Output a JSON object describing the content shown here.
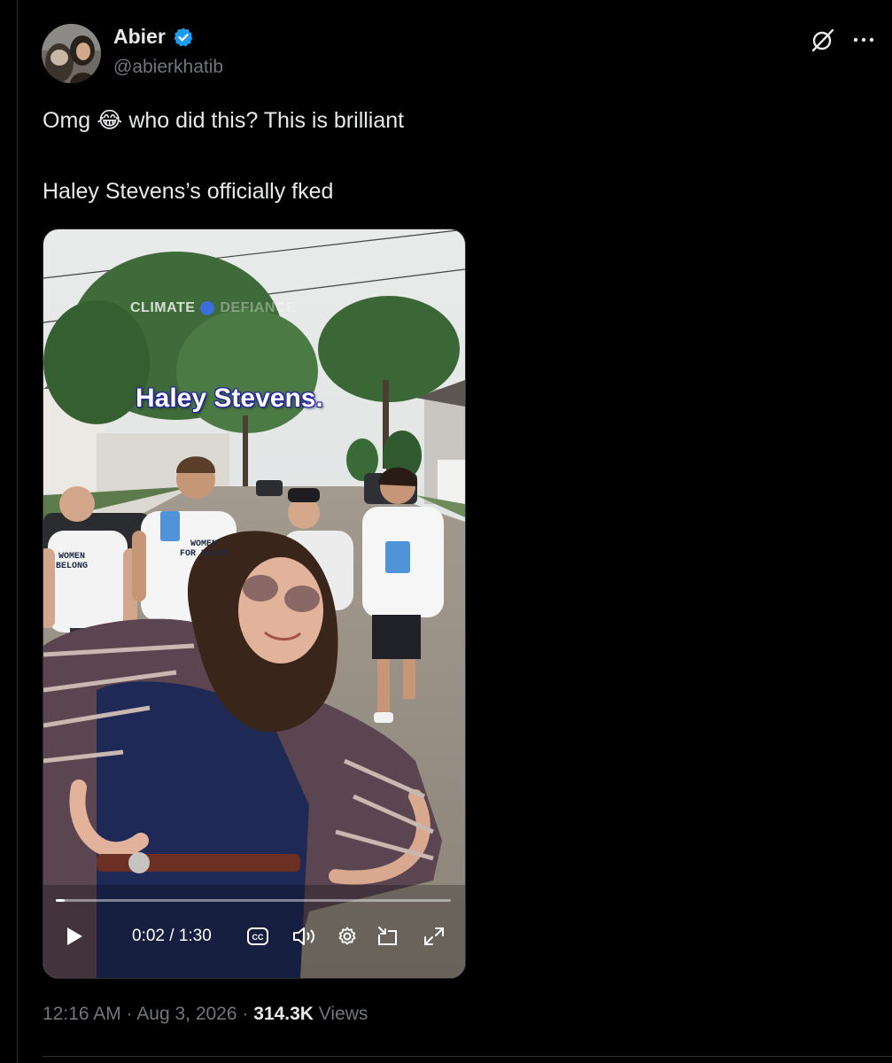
{
  "author": {
    "name": "Abier",
    "handle": "@abierkhatib",
    "verified": true
  },
  "tweet": {
    "line1_before": "Omg",
    "emoji": "😂",
    "line1_after": "who did this? This is brilliant",
    "line2": "Haley Stevens’s officially fked"
  },
  "video": {
    "watermark_left": "CLIMATE",
    "watermark_right": "DEFIANCE",
    "caption": "Haley Stevens.",
    "shirt_1": "WOMEN\nBELONG",
    "shirt_2": "WOMEN\nFOR HALEY",
    "time_display": "0:02 / 1:30",
    "progress_fraction": 0.022
  },
  "footer": {
    "time": "12:16 AM",
    "date": "Aug 3, 2026",
    "views_count": "314.3K",
    "views_label": "Views",
    "separator": "·"
  },
  "colors": {
    "background": "#000000",
    "text": "#e7e9ea",
    "muted": "#71767b",
    "verified_badge": "#1d9bf0",
    "divider": "#2f3336"
  },
  "icons": {
    "grok": "grok-icon",
    "more": "more-icon",
    "verified": "verified-badge-icon",
    "play": "play-icon",
    "captions": "captions-icon",
    "volume": "volume-icon",
    "settings": "settings-gear-icon",
    "pip": "picture-in-picture-icon",
    "fullscreen": "fullscreen-icon"
  }
}
